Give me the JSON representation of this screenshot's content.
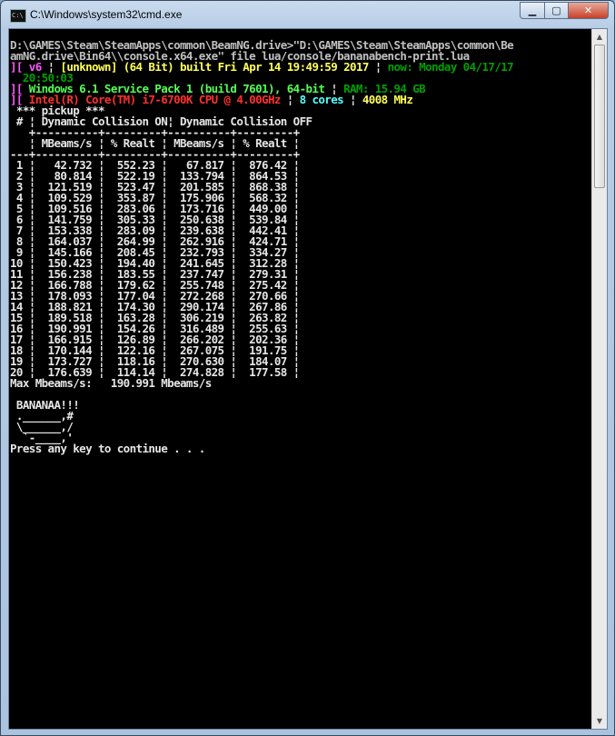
{
  "window": {
    "title": "C:\\Windows\\system32\\cmd.exe",
    "app_icon_text": "C:\\",
    "minimize_glyph": "▁",
    "maximize_glyph": "▢",
    "close_glyph": "✕"
  },
  "console": {
    "command_line_1": "D:\\GAMES\\Steam\\SteamApps\\common\\BeamNG.drive>\"D:\\GAMES\\Steam\\SteamApps\\common\\Be",
    "command_line_2": "amNG.drive\\Bin64\\\\console.x64.exe\" file lua/console/bananabench-print.lua",
    "build": {
      "bracket": "][ ",
      "version": "v6",
      "sep1": " ¦ ",
      "branch": "[unknown]",
      "built": " (64 Bit) built Fri Apr 14 19:49:59 2017",
      "sep2": " ¦ ",
      "now": "now: Monday 04/17/17",
      "now_cont": "  20:50:03"
    },
    "os": {
      "bracket": "][ ",
      "text": "Windows 6.1 Service Pack 1 (build 7601), 64-bit",
      "sep": " ¦ ",
      "ram": "RAM: 15.94 GB"
    },
    "cpu": {
      "bracket": "][ ",
      "text": "Intel(R) Core(TM) i7-6700K CPU @ 4.00GHz",
      "sep1": " ¦ ",
      "cores": "8 cores",
      "sep2": " ¦ ",
      "mhz": "4008 MHz"
    },
    "bench_title": " *** pickup ***",
    "table": {
      "header1": " # ¦ Dynamic Collision ON¦ Dynamic Collision OFF",
      "divider1": "   +----------+---------+----------+---------+",
      "header2": "   ¦ MBeams/s ¦ % Realt ¦ MBeams/s ¦ % Realt ¦",
      "divider2": "---+----------+---------+----------+---------+",
      "rows": [
        " 1 ¦   42.732 ¦  552.23 ¦   67.817 ¦  876.42 ¦",
        " 2 ¦   80.814 ¦  522.19 ¦  133.794 ¦  864.53 ¦",
        " 3 ¦  121.519 ¦  523.47 ¦  201.585 ¦  868.38 ¦",
        " 4 ¦  109.529 ¦  353.87 ¦  175.906 ¦  568.32 ¦",
        " 5 ¦  109.516 ¦  283.06 ¦  173.716 ¦  449.00 ¦",
        " 6 ¦  141.759 ¦  305.33 ¦  250.638 ¦  539.84 ¦",
        " 7 ¦  153.338 ¦  283.09 ¦  239.638 ¦  442.41 ¦",
        " 8 ¦  164.037 ¦  264.99 ¦  262.916 ¦  424.71 ¦",
        " 9 ¦  145.166 ¦  208.45 ¦  232.793 ¦  334.27 ¦",
        "10 ¦  150.423 ¦  194.40 ¦  241.645 ¦  312.28 ¦",
        "11 ¦  156.238 ¦  183.55 ¦  237.747 ¦  279.31 ¦",
        "12 ¦  166.788 ¦  179.62 ¦  255.748 ¦  275.42 ¦",
        "13 ¦  178.093 ¦  177.04 ¦  272.268 ¦  270.66 ¦",
        "14 ¦  188.821 ¦  174.30 ¦  290.174 ¦  267.86 ¦",
        "15 ¦  189.518 ¦  163.28 ¦  306.219 ¦  263.82 ¦",
        "16 ¦  190.991 ¦  154.26 ¦  316.489 ¦  255.63 ¦",
        "17 ¦  166.915 ¦  126.89 ¦  266.202 ¦  202.36 ¦",
        "18 ¦  170.144 ¦  122.16 ¦  267.075 ¦  191.75 ¦",
        "19 ¦  173.727 ¦  118.16 ¦  270.630 ¦  184.07 ¦",
        "20 ¦  176.639 ¦  114.14 ¦  274.828 ¦  177.58 ¦"
      ]
    },
    "max_line": "Max Mbeams/s:   190.991 Mbeams/s",
    "banana": [
      " BANANAA!!!",
      " .______,#",
      " \\______,/",
      "  `-____,'"
    ],
    "prompt": "Press any key to continue . . ."
  },
  "scrollbar": {
    "up_glyph": "▲",
    "down_glyph": "▼"
  }
}
